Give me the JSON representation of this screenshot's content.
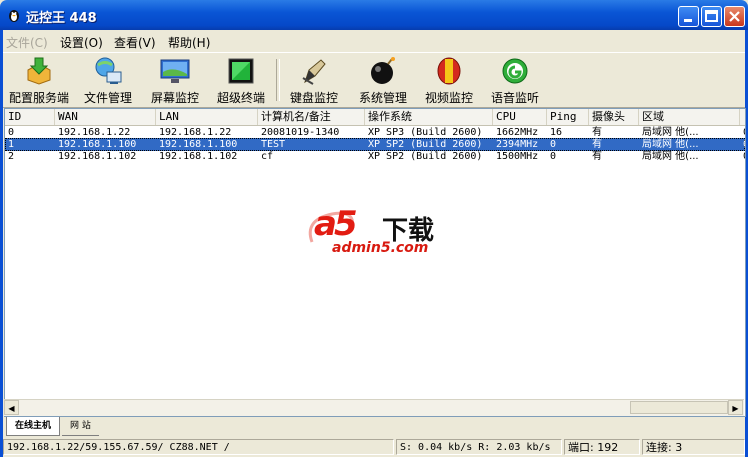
{
  "window": {
    "title": "远控王 448"
  },
  "menu": [
    "文件(C)",
    "设置(O)",
    "查看(V)",
    "帮助(H)"
  ],
  "toolbar": [
    {
      "label": "配置服务端",
      "icon": "download-config-icon"
    },
    {
      "label": "文件管理",
      "icon": "file-manager-icon"
    },
    {
      "label": "屏幕监控",
      "icon": "screen-monitor-icon"
    },
    {
      "label": "超级终端",
      "icon": "terminal-icon"
    },
    {
      "label": "键盘监控",
      "icon": "keyboard-pen-icon"
    },
    {
      "label": "系统管理",
      "icon": "bomb-icon"
    },
    {
      "label": "视频监控",
      "icon": "video-icon"
    },
    {
      "label": "语音监听",
      "icon": "audio-icon"
    }
  ],
  "table": {
    "columns": [
      "ID",
      "WAN",
      "LAN",
      "计算机名/备注",
      "操作系统",
      "CPU",
      "Ping",
      "摄像头",
      "区域",
      ""
    ],
    "rows": [
      [
        "0",
        "192.168.1.22",
        "192.168.1.22",
        "20081019-1340",
        "XP SP3 (Build 2600)",
        "1662MHz",
        "16",
        "有",
        "局域网 他(...",
        "0"
      ],
      [
        "1",
        "192.168.1.100",
        "192.168.1.100",
        "TEST",
        "XP SP2 (Build 2600)",
        "2394MHz",
        "0",
        "有",
        "局域网 他(...",
        "0"
      ],
      [
        "2",
        "192.168.1.102",
        "192.168.1.102",
        "cf",
        "XP SP2 (Build 2600)",
        "1500MHz",
        "0",
        "有",
        "局域网 他(...",
        "0"
      ]
    ],
    "selected_row": 1
  },
  "tabs": [
    "在线主机",
    "网 站"
  ],
  "status": {
    "address": "192.168.1.22/59.155.67.59/ CZ88.NET /",
    "speed": "S: 0.04 kb/s R: 2.03 kb/s",
    "port": "端口: 192",
    "connections": "连接: 3"
  },
  "watermark": {
    "logo": "a5",
    "text": "下载",
    "site": "admin5.com"
  },
  "colors": {
    "titlebar": "#0a56d6",
    "selection": "#316ac5",
    "chrome": "#ece9d8"
  }
}
